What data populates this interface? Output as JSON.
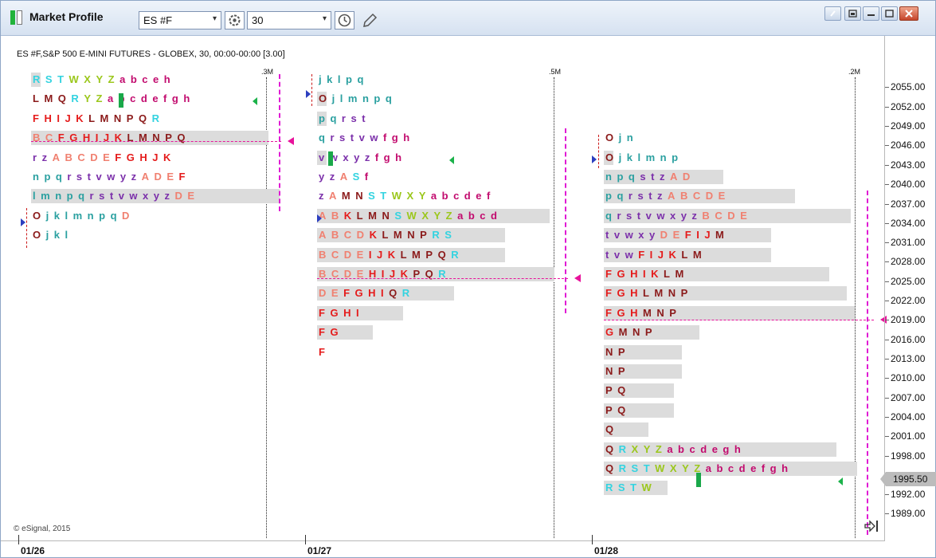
{
  "window": {
    "title": "Market Profile",
    "symbol": "ES #F",
    "interval": "30"
  },
  "chart": {
    "header": "ES #F,S&P 500 E-MINI FUTURES - GLOBEX, 30, 00:00-00:00  [3.00]",
    "watermark": "© eSignal, 2015",
    "current_price": "1995.50",
    "price_labels": [
      "2055.00",
      "2052.00",
      "2049.00",
      "2046.00",
      "2043.00",
      "2040.00",
      "2037.00",
      "2034.00",
      "2031.00",
      "2028.00",
      "2025.00",
      "2022.00",
      "2019.00",
      "2016.00",
      "2013.00",
      "2010.00",
      "2007.00",
      "2004.00",
      "2001.00",
      "1998.00",
      "1992.00",
      "1989.00"
    ],
    "dates": [
      "01/26",
      "01/27",
      "01/28"
    ],
    "volume_labels": [
      ".3M",
      ".5M",
      ".2M"
    ]
  },
  "profiles": {
    "d1": [
      "R S T W X Y Z a b c e h",
      "L M Q R Y Z a b c d e f g h",
      "F H I J K L M N P Q R",
      "B C F G H I J K L M N P Q",
      "r z A B C D E F G H J K",
      "n p q r s t v w y z A D E F",
      "l m n p q r s t v w x y z D E",
      "O j k l m n p q D",
      "O j k l"
    ],
    "d2": [
      "j k l p q",
      "O j l m n p q",
      "p q r s t",
      "q r s t v w f g h",
      "v w x y z f g h",
      "y z A S f",
      "z A M N S T W X Y a b c d e f",
      "A B K L M N S W X Y Z a b c d",
      "A B C D K L M N P R S",
      "B C D E I J K L M P Q R",
      "B C D E H I J K P Q R",
      "D E F G H I Q R",
      "F G H I",
      "F G",
      "F"
    ],
    "d3": [
      "O j n",
      "O j k l m n p",
      "n p q s t z A D",
      "p q r s t z A B C D E",
      "q r s t v w x y z B C D E",
      "t v w x y D E F I J M",
      "t v w F I J K L M",
      "F G H I K L M",
      "F G H L M N P",
      "F G H M N P",
      "G M N P",
      "N P",
      "N P",
      "P Q",
      "P Q",
      "Q",
      "Q R X Y Z a b c d e g h",
      "Q R S T W X Y Z a b c d e f g h",
      "R S T W"
    ]
  },
  "colors": {
    "letter_palette": [
      "#e51b1b",
      "#8b1a1a",
      "#2aa0a0",
      "#33d3e0",
      "#9bc71c",
      "#7b2faa",
      "#c20b6e",
      "#f08070"
    ],
    "poc": "#e8139b",
    "value_area": "#e01bd4"
  },
  "icons": [
    "app-icon",
    "gear-icon",
    "clock-icon",
    "pencil-icon",
    "help-icon",
    "restore-icon",
    "minimize-icon",
    "maximize-icon",
    "close-icon",
    "exit-icon"
  ]
}
